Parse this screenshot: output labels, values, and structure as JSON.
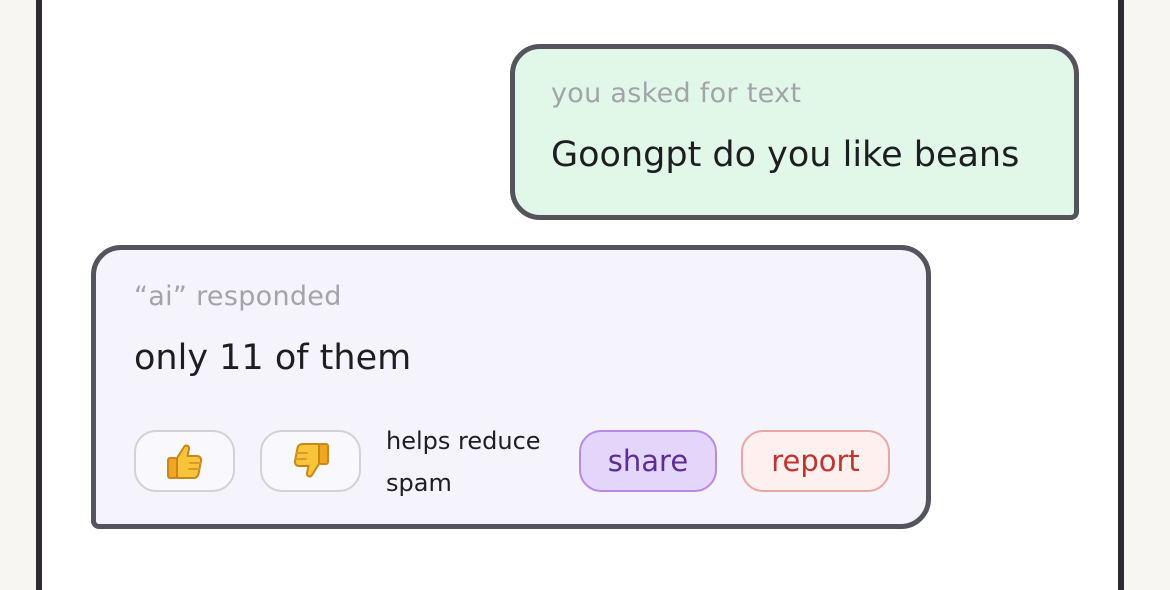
{
  "user_message": {
    "meta": "you asked for text",
    "text": "Goongpt do you like beans"
  },
  "ai_message": {
    "meta": "“ai” responded",
    "text": "only 11 of them",
    "hint": "helps reduce spam",
    "share_label": "share",
    "report_label": "report",
    "thumbs_up_icon": "thumbs-up-icon",
    "thumbs_down_icon": "thumbs-down-icon"
  },
  "colors": {
    "user_bubble_bg": "#e1f8e8",
    "ai_bubble_bg": "#f5f3fc",
    "bubble_border": "#54545c",
    "share_accent": "#5d2c94",
    "report_accent": "#c2322e"
  }
}
